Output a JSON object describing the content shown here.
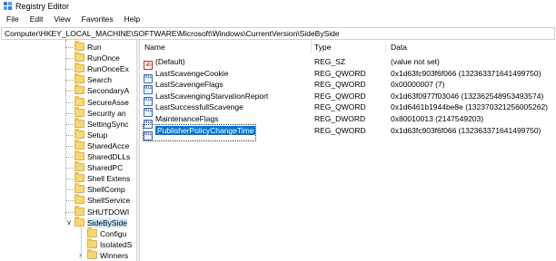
{
  "window": {
    "title": "Registry Editor",
    "icon": "registry-editor-icon"
  },
  "menu": [
    "File",
    "Edit",
    "View",
    "Favorites",
    "Help"
  ],
  "address": "Computer\\HKEY_LOCAL_MACHINE\\SOFTWARE\\Microsoft\\Windows\\CurrentVersion\\SideBySide",
  "tree": {
    "items": [
      "Run",
      "RunOnce",
      "RunOnceEx",
      "Search",
      "SecondaryA",
      "SecureAsse",
      "Security an",
      "SettingSync",
      "Setup",
      "SharedAcce",
      "SharedDLLs",
      "SharedPC",
      "Shell Extens",
      "ShellComp",
      "ShellService",
      "SHUTDOWI",
      "SideBySide"
    ],
    "selected": "SideBySide",
    "children": [
      "Configu",
      "IsolatedS",
      "Winners"
    ]
  },
  "columns": {
    "name": "Name",
    "type": "Type",
    "data": "Data"
  },
  "values": [
    {
      "name": "(Default)",
      "type": "REG_SZ",
      "data": "(value not set)",
      "icon": "string-value-icon",
      "glyph": "ab"
    },
    {
      "name": "LastScavengeCookie",
      "type": "REG_QWORD",
      "data": "0x1d63fc903f6f066 (132363371641499750)",
      "icon": "binary-value-icon",
      "glyph": "011"
    },
    {
      "name": "LastScavengeFlags",
      "type": "REG_QWORD",
      "data": "0x00000007 (7)",
      "icon": "binary-value-icon",
      "glyph": "011"
    },
    {
      "name": "LastScavengingStarvationReport",
      "type": "REG_QWORD",
      "data": "0x1d63f0977f03046 (132362548953493574)",
      "icon": "binary-value-icon",
      "glyph": "011"
    },
    {
      "name": "LastSuccessfullScavenge",
      "type": "REG_QWORD",
      "data": "0x1d6461b1944be8e (132370321256005262)",
      "icon": "binary-value-icon",
      "glyph": "011"
    },
    {
      "name": "MaintenanceFlags",
      "type": "REG_DWORD",
      "data": "0x80010013 (2147549203)",
      "icon": "binary-value-icon",
      "glyph": "011"
    },
    {
      "name": "PublisherPolicyChangeTime",
      "type": "REG_QWORD",
      "data": "0x1d63fc903f6f066 (132363371641499750)",
      "icon": "binary-value-icon",
      "glyph": "011"
    }
  ],
  "selected_value": "PublisherPolicyChangeTime",
  "colors": {
    "selection": "#0078d7",
    "tree_selection": "#cce8ff",
    "folder": "#f7d674"
  }
}
